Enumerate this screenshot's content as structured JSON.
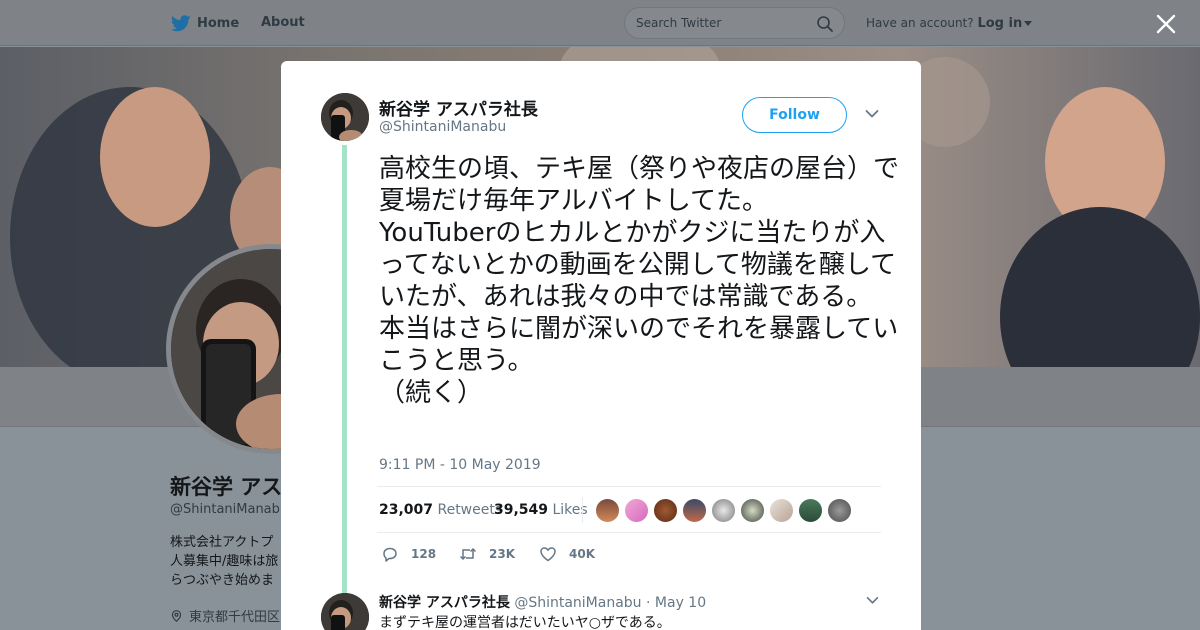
{
  "nav": {
    "home": "Home",
    "about": "About",
    "search_placeholder": "Search Twitter",
    "have_account": "Have an account?",
    "login": "Log in"
  },
  "profile_bg": {
    "name": "新谷学 アス",
    "handle": "@ShintaniManabu",
    "bio_lines": [
      "株式会社アクトプ",
      "人募集中/趣味は旅",
      "らつぶやき始めま"
    ],
    "location": "東京都千代田区"
  },
  "tweet": {
    "author_name": "新谷学 アスパラ社長",
    "author_handle": "@ShintaniManabu",
    "follow_label": "Follow",
    "text": "高校生の頃、テキ屋（祭りや夜店の屋台）で夏場だけ毎年アルバイトしてた。\nYouTuberのヒカルとかがクジに当たりが入ってないとかの動画を公開して物議を醸していたが、あれは我々の中では常識である。\n本当はさらに闇が深いのでそれを暴露していこうと思う。\n（続く）",
    "timestamp": "9:11 PM - 10 May 2019",
    "retweets_count": "23,007",
    "retweets_label": "Retweets",
    "likes_count": "39,549",
    "likes_label": "Likes",
    "reply_count": "128",
    "retweet_action_count": "23K",
    "like_action_count": "40K"
  },
  "reply": {
    "author_name": "新谷学 アスパラ社長",
    "author_handle": "@ShintaniManabu",
    "date": "· May 10",
    "text": "まずテキ屋の運営者はだいたいヤ○ザである。"
  },
  "colors": {
    "accent": "#1da1f2",
    "thread_line": "#a4e3c8",
    "muted_text": "#657786"
  },
  "icons": [
    "twitter-bird-icon",
    "search-icon",
    "close-icon",
    "chevron-down-icon",
    "reply-icon",
    "retweet-icon",
    "heart-icon",
    "location-icon"
  ]
}
